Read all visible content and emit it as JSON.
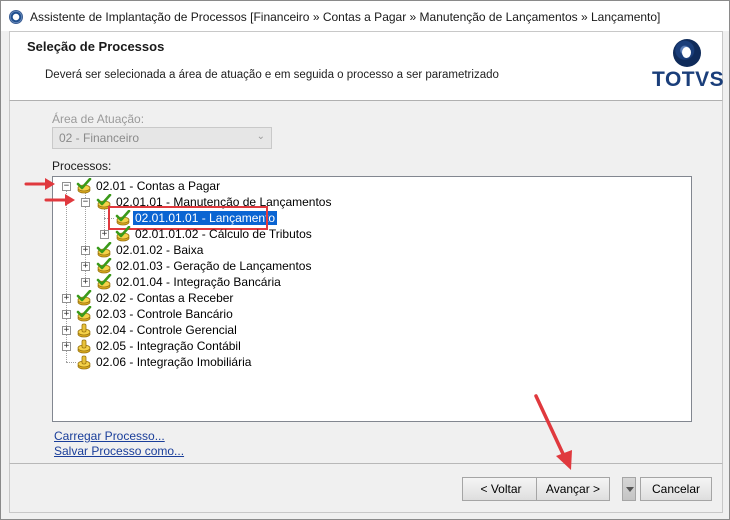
{
  "window": {
    "title": "Assistente de Implantação de Processos [Financeiro » Contas a Pagar » Manutenção de Lançamentos » Lançamento]"
  },
  "header": {
    "title": "Seleção de Processos",
    "subtitle": "Deverá ser selecionada a área de atuação e em seguida o processo a ser parametrizado",
    "logo_text": "TOTVS"
  },
  "form": {
    "area_label": "Área de Atuação:",
    "area_value": "02 - Financeiro",
    "processes_label": "Processos:"
  },
  "tree": {
    "nodes": [
      {
        "label": "02.01 - Contas a Pagar",
        "state": "checked",
        "expanded": true
      },
      {
        "label": "02.01.01 - Manutenção de Lançamentos",
        "state": "checked",
        "expanded": true
      },
      {
        "label": "02.01.01.01 - Lançamento",
        "state": "checked",
        "selected": true
      },
      {
        "label": "02.01.01.02 - Cálculo de Tributos",
        "state": "checked",
        "expanded": false
      },
      {
        "label": "02.01.02 - Baixa",
        "state": "checked",
        "expanded": false
      },
      {
        "label": "02.01.03 - Geração de Lançamentos",
        "state": "checked",
        "expanded": false
      },
      {
        "label": "02.01.04 - Integração Bancária",
        "state": "checked",
        "expanded": false
      },
      {
        "label": "02.02 - Contas a Receber",
        "state": "checked",
        "expanded": false
      },
      {
        "label": "02.03 - Controle Bancário",
        "state": "checked",
        "expanded": false
      },
      {
        "label": "02.04 - Controle Gerencial",
        "state": "partial",
        "expanded": false
      },
      {
        "label": "02.05 - Integração Contábil",
        "state": "partial",
        "expanded": false
      },
      {
        "label": "02.06 - Integração Imobiliária",
        "state": "partial"
      }
    ]
  },
  "links": {
    "load": "Carregar Processo...",
    "save": "Salvar Processo como..."
  },
  "buttons": {
    "back": "< Voltar",
    "next": "Avançar >",
    "cancel": "Cancelar"
  },
  "colors": {
    "selection": "#0a64d2",
    "highlight_box": "#e0393e",
    "annotation_arrow": "#e0393e",
    "brand": "#1a3e7a"
  }
}
